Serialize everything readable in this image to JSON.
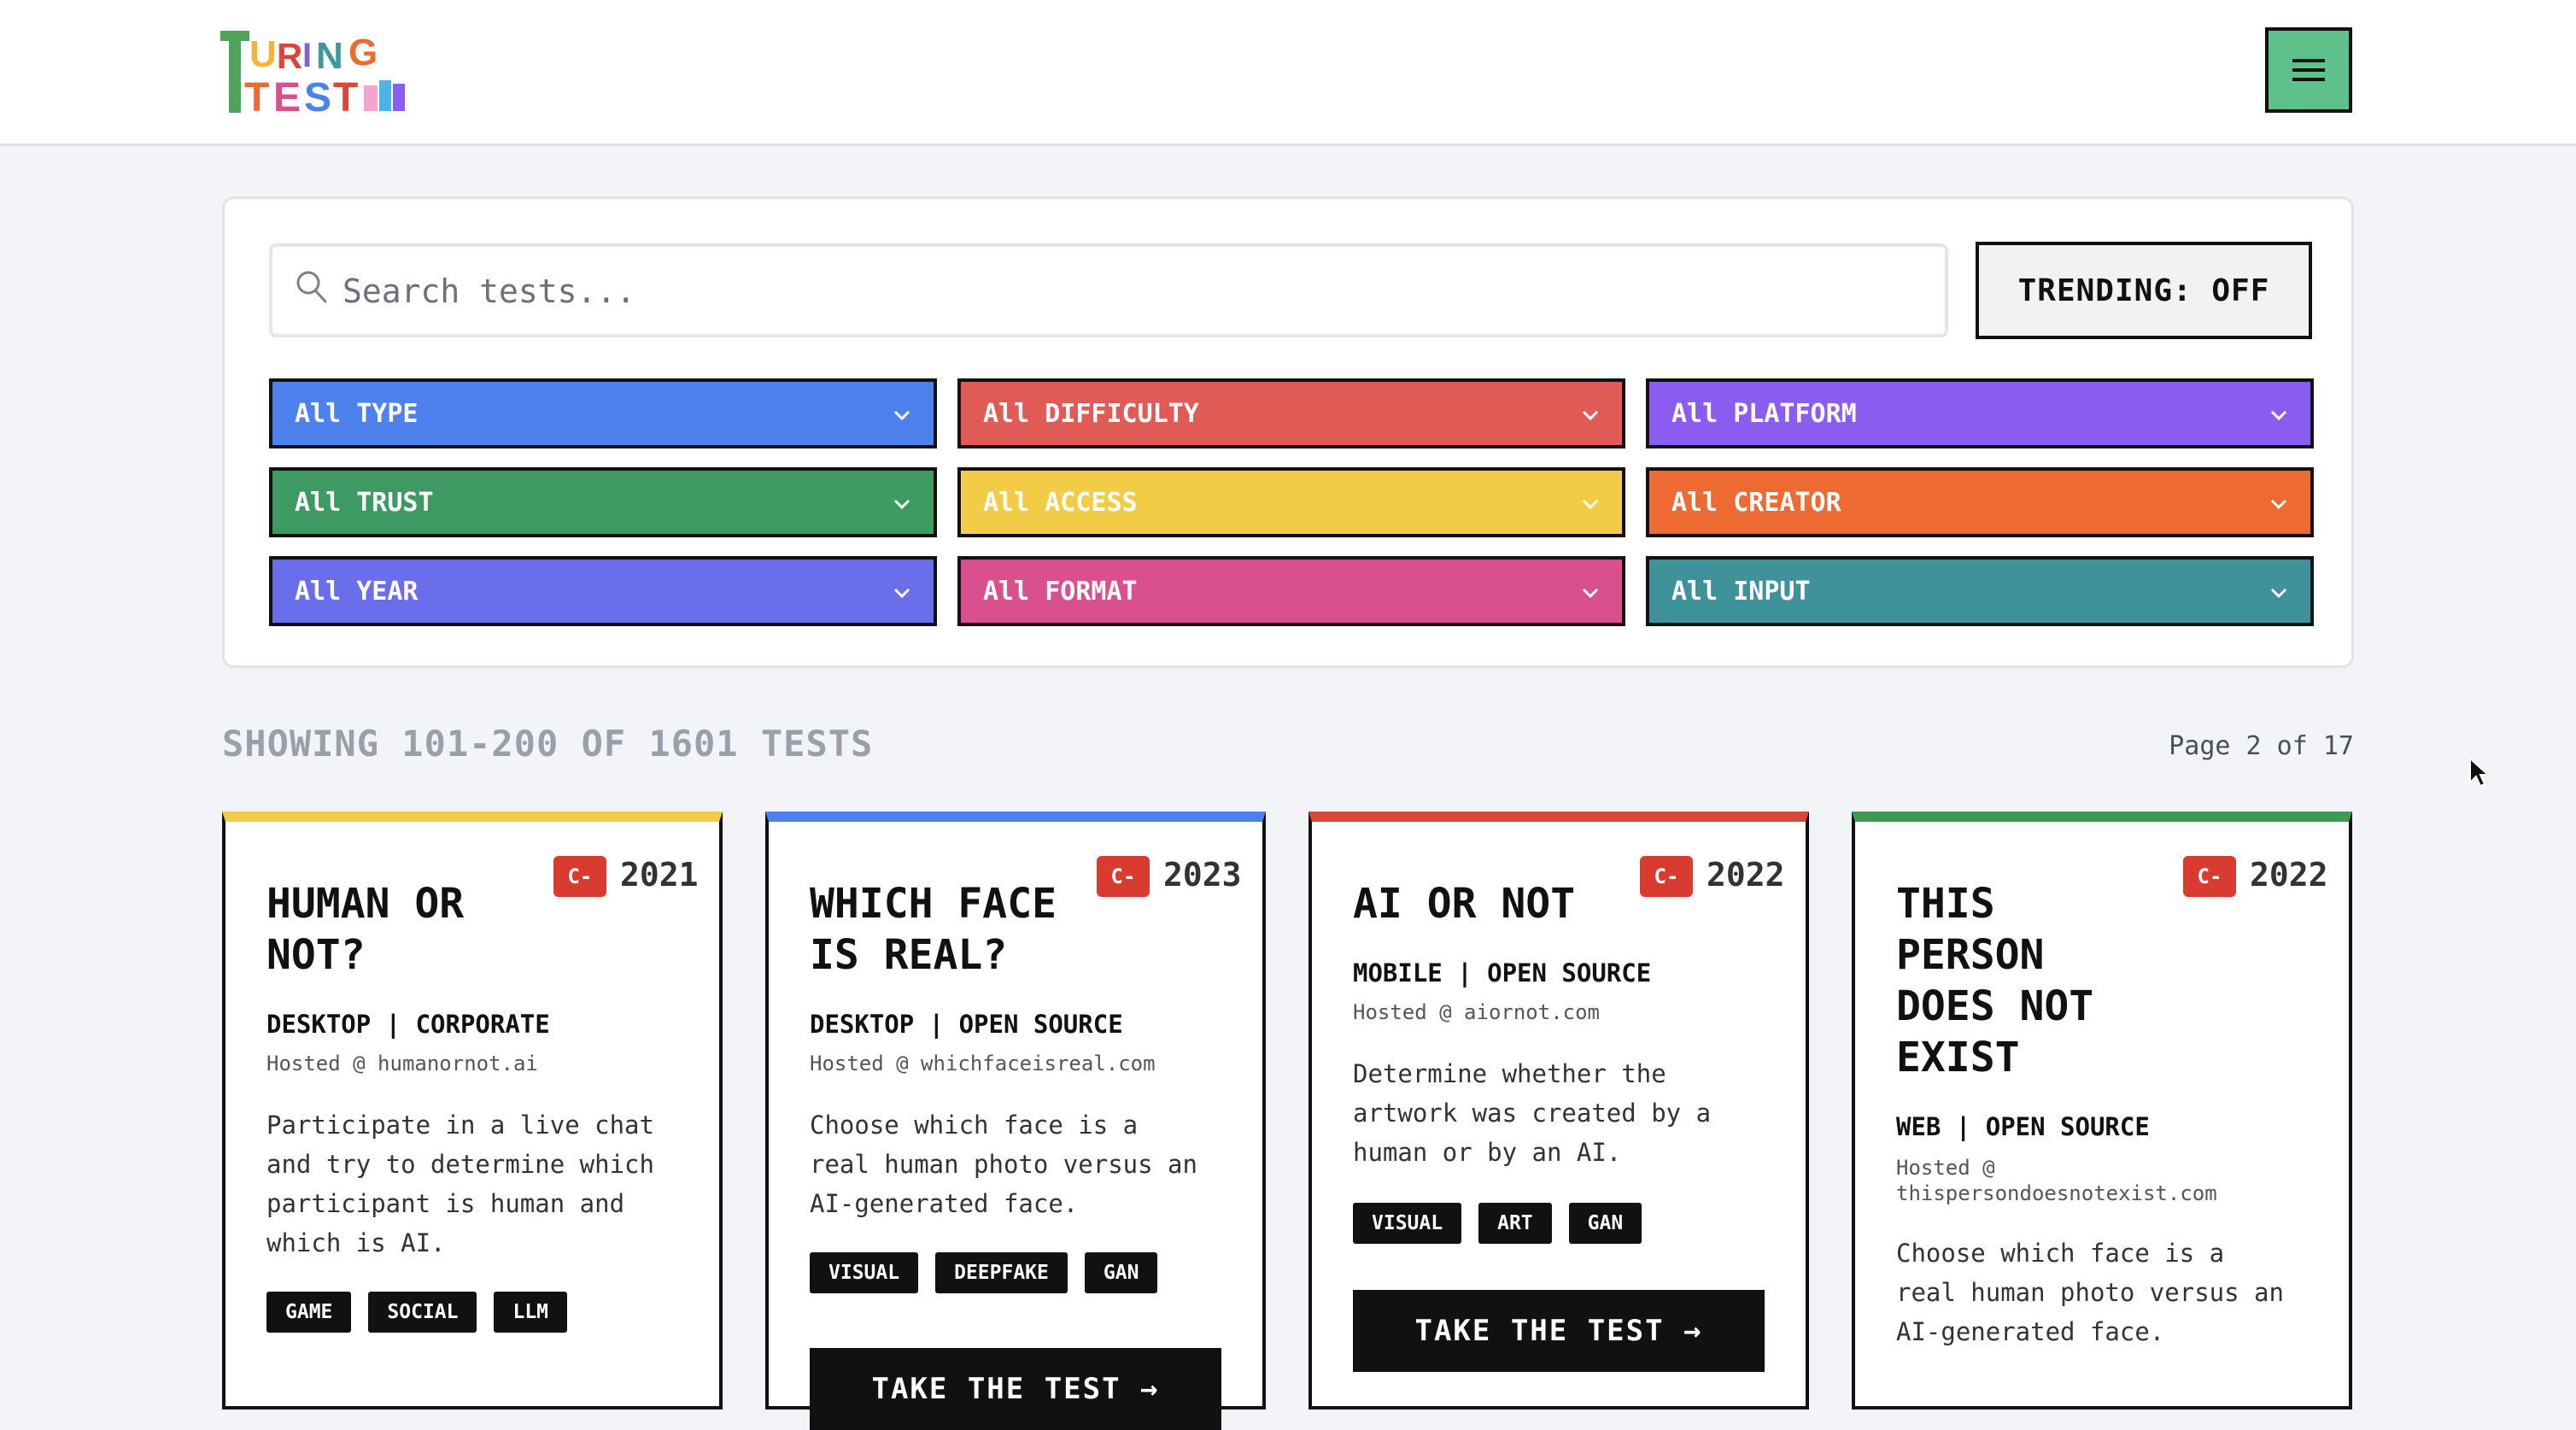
{
  "header": {
    "logo_line1": "TURING",
    "logo_line2": "TEST",
    "menu_icon": "hamburger-icon"
  },
  "search": {
    "placeholder": "Search tests...",
    "icon": "search-icon"
  },
  "trending": {
    "label": "TRENDING: OFF"
  },
  "filters": [
    {
      "label": "All TYPE",
      "color": "#4d82ee"
    },
    {
      "label": "All DIFFICULTY",
      "color": "#e05b55"
    },
    {
      "label": "All PLATFORM",
      "color": "#8b5cf0"
    },
    {
      "label": "All TRUST",
      "color": "#3d9a62"
    },
    {
      "label": "All ACCESS",
      "color": "#f3cc47"
    },
    {
      "label": "All CREATOR",
      "color": "#ee6a33"
    },
    {
      "label": "All YEAR",
      "color": "#6a6eea"
    },
    {
      "label": "All FORMAT",
      "color": "#d8508e"
    },
    {
      "label": "All INPUT",
      "color": "#3f929a"
    }
  ],
  "results": {
    "showing": "SHOWING 101-200 OF 1601 TESTS",
    "page": "Page 2 of 17"
  },
  "cards": [
    {
      "accent": "#f3cc47",
      "title": "HUMAN OR NOT?",
      "grade": "C-",
      "year": "2021",
      "meta": "DESKTOP | CORPORATE",
      "hosted": "Hosted @ humanornot.ai",
      "description": "Participate in a live chat and try to determine which participant is human and which is AI.",
      "tags": [
        "GAME",
        "SOCIAL",
        "LLM"
      ]
    },
    {
      "accent": "#4d82ee",
      "title": "WHICH FACE IS REAL?",
      "grade": "C-",
      "year": "2023",
      "meta": "DESKTOP | OPEN SOURCE",
      "hosted": "Hosted @ whichfaceisreal.com",
      "description": "Choose which face is a real human photo versus an AI-generated face.",
      "tags": [
        "VISUAL",
        "DEEPFAKE",
        "GAN"
      ],
      "button": "TAKE THE TEST →"
    },
    {
      "accent": "#d9473a",
      "title": "AI OR NOT",
      "grade": "C-",
      "year": "2022",
      "meta": "MOBILE | OPEN SOURCE",
      "hosted": "Hosted @ aiornot.com",
      "description": "Determine whether the artwork was created by a human or by an AI.",
      "tags": [
        "VISUAL",
        "ART",
        "GAN"
      ],
      "button": "TAKE THE TEST →"
    },
    {
      "accent": "#3d9a52",
      "title": "THIS PERSON DOES NOT EXIST",
      "grade": "C-",
      "year": "2022",
      "meta": "WEB | OPEN SOURCE",
      "hosted": "Hosted @ thispersondoesnotexist.com",
      "description": "Choose which face is a real human photo versus an AI-generated face."
    }
  ]
}
